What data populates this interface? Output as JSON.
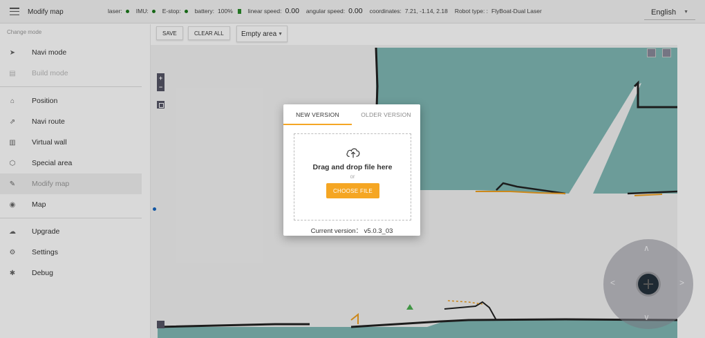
{
  "header": {
    "title": "Modify map",
    "status": {
      "laser_label": "laser:",
      "imu_label": "IMU:",
      "estop_label": "E-stop:",
      "battery_label": "battery:",
      "battery_value": "100%",
      "linear_label": "linear speed:",
      "linear_value": "0.00",
      "angular_label": "angular speed:",
      "angular_value": "0.00",
      "coords_label": "coordinates:",
      "coords_value": "7.21, -1.14, 2.18",
      "robot_label": "Robot type: :",
      "robot_value": "FlyBoat-Dual Laser",
      "status_color": "#1a7a1a"
    },
    "language": "English"
  },
  "sidebar": {
    "section_label": "Change mode",
    "items": [
      {
        "label": "Navi mode",
        "icon": "send-icon"
      },
      {
        "label": "Build mode",
        "icon": "build-icon"
      },
      {
        "label": "Position",
        "icon": "position-icon"
      },
      {
        "label": "Navi route",
        "icon": "route-icon"
      },
      {
        "label": "Virtual wall",
        "icon": "wall-icon"
      },
      {
        "label": "Special area",
        "icon": "area-icon"
      },
      {
        "label": "Modify map",
        "icon": "modify-icon"
      },
      {
        "label": "Map",
        "icon": "map-icon"
      },
      {
        "label": "Upgrade",
        "icon": "upgrade-icon"
      },
      {
        "label": "Settings",
        "icon": "gear-icon"
      },
      {
        "label": "Debug",
        "icon": "debug-icon"
      }
    ]
  },
  "toolbar": {
    "save_label": "SAVE",
    "clear_label": "CLEAR ALL",
    "area_select": "Empty area"
  },
  "dialog": {
    "tabs": [
      "NEW VERSION",
      "OLDER VERSION"
    ],
    "active_tab": "NEW VERSION",
    "drop_title": "Drag and drop file here",
    "or_text": "or",
    "choose_label": "CHOOSE FILE",
    "current_version": "Current version： v5.0.3_03",
    "accent_color": "#f5a623"
  },
  "map": {
    "free_space_color": "#7fb8b4",
    "wall_color": "#222222",
    "path_color": "#f0a020"
  }
}
